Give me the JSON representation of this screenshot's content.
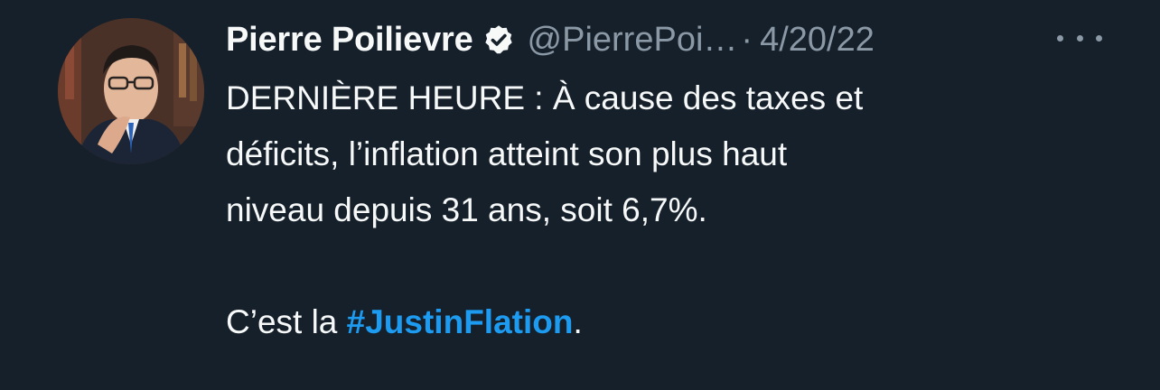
{
  "tweet": {
    "author_name": "Pierre Poilievre",
    "author_handle": "@PierrePoi…",
    "separator": "·",
    "date": "4/20/22",
    "lines": [
      "DERNIÈRE HEURE : À cause des taxes et",
      "déficits, l’inflation atteint son plus haut",
      "niveau depuis 31 ans, soit 6,7%."
    ],
    "last_line_prefix": "C’est la ",
    "hashtag": "#JustinFlation",
    "last_line_suffix": "."
  },
  "icons": {
    "verified": "verified-badge-icon",
    "more": "more-options-icon"
  },
  "colors": {
    "background": "#15202b",
    "text": "#f7f9f9",
    "secondary": "#8b98a5",
    "link": "#1d9bf0"
  }
}
